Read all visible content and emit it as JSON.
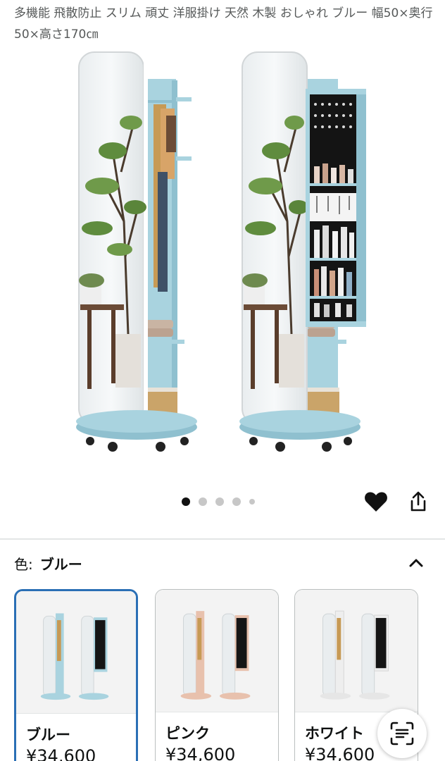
{
  "product": {
    "title": "多機能 飛散防止 スリム 頑丈 洋服掛け 天然 木製 おしゃれ ブルー 幅50×奥行50×高さ170㎝"
  },
  "carousel": {
    "active_index": 0,
    "count": 5
  },
  "color": {
    "label": "色:",
    "selected": "ブルー"
  },
  "variants": [
    {
      "name": "ブルー",
      "price": "¥34,600",
      "frame_color": "#a9d3df",
      "selected": true
    },
    {
      "name": "ピンク",
      "price": "¥34,600",
      "frame_color": "#e8c1ad",
      "selected": false
    },
    {
      "name": "ホワイト",
      "price": "¥34,600",
      "frame_color": "#eeeeee",
      "selected": false
    }
  ],
  "icons": {
    "wishlist": "heart-icon",
    "share": "share-icon",
    "collapse": "chevron-up-icon",
    "lens": "scan-text-icon"
  }
}
